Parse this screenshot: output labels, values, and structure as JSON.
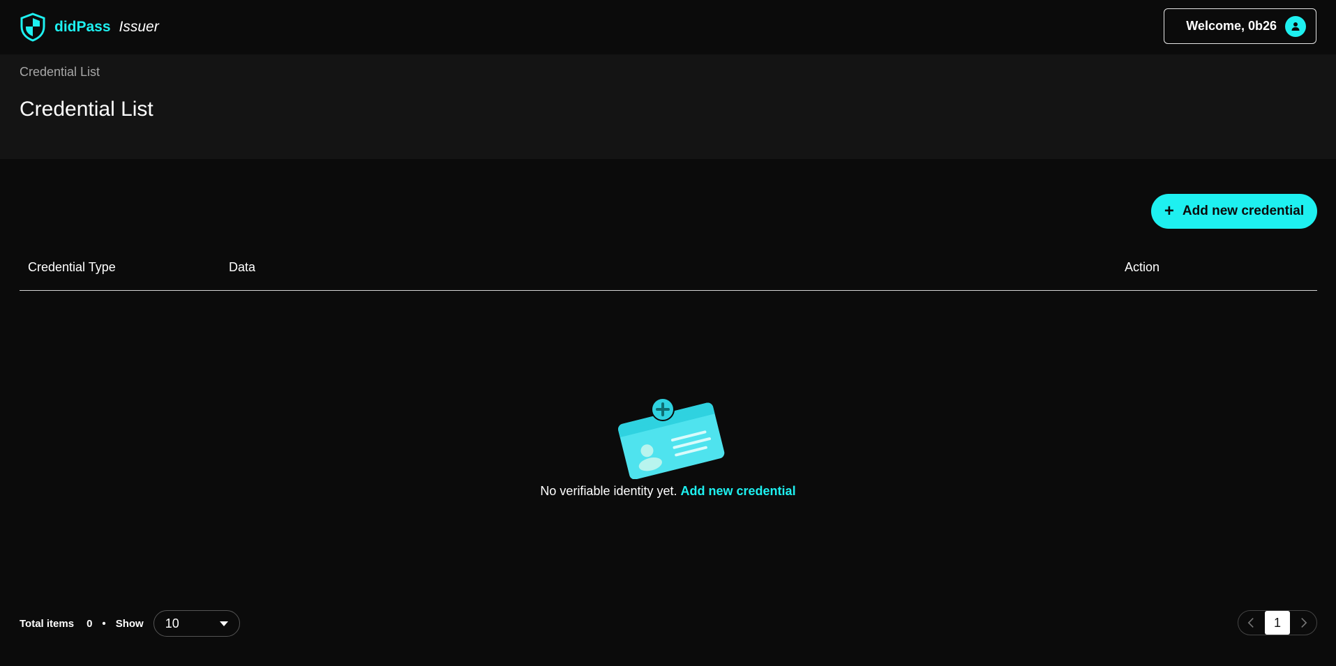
{
  "header": {
    "brand": "didPass",
    "brand_sub": "Issuer",
    "welcome": "Welcome, 0b26"
  },
  "page": {
    "breadcrumb": "Credential List",
    "title": "Credential List"
  },
  "actions": {
    "add_label": "Add new credential"
  },
  "table": {
    "columns": [
      "Credential Type",
      "Data",
      "Action"
    ]
  },
  "empty_state": {
    "message": "No verifiable identity yet.",
    "link": "Add new credential"
  },
  "footer": {
    "total_label": "Total items",
    "total_count": "0",
    "separator": "•",
    "show_label": "Show",
    "page_size": "10",
    "current_page": "1"
  },
  "icons": {
    "logo": "shield-icon",
    "avatar": "user-icon",
    "add": "plus-icon",
    "empty": "id-card-icon",
    "dropdown": "caret-down-icon",
    "prev": "chevron-left-icon",
    "next": "chevron-right-icon"
  },
  "colors": {
    "accent": "#1ef0f0",
    "background": "#0b0b0b",
    "header_band": "#141414"
  }
}
